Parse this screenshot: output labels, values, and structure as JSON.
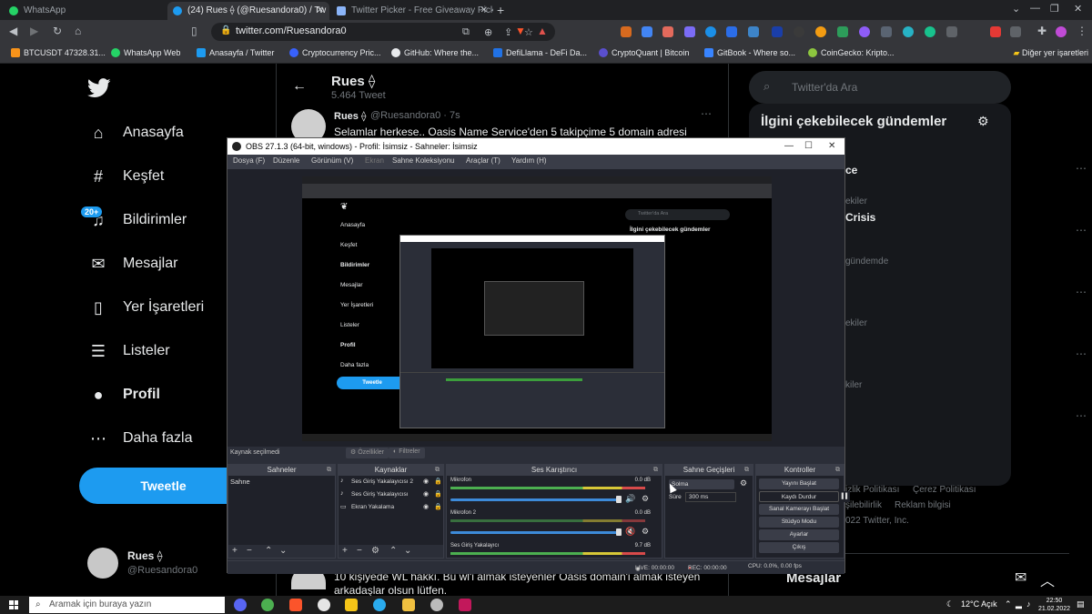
{
  "browser": {
    "tabs": [
      {
        "title": "WhatsApp",
        "icon": "whatsapp-icon",
        "color": "#25d366"
      },
      {
        "title": "(24) Rues ⟠ (@Ruesandora0) / Tw",
        "icon": "twitter-icon",
        "color": "#1d9bf0"
      },
      {
        "title": "Twitter Picker - Free Giveaway Picker",
        "icon": "twitter-picker-icon",
        "color": "#8ab4f8"
      }
    ],
    "new_tab": "+",
    "url": "twitter.com/Ruesandora0",
    "bookmarks": [
      {
        "label": "BTCUSDT 47328.31...",
        "color": "#f7931a"
      },
      {
        "label": "WhatsApp Web",
        "color": "#25d366"
      },
      {
        "label": "Anasayfa / Twitter",
        "color": "#1d9bf0"
      },
      {
        "label": "Cryptocurrency Pric...",
        "color": "#3861fb"
      },
      {
        "label": "GitHub: Where the...",
        "color": "#e8eaed"
      },
      {
        "label": "DefiLlama - DeFi Da...",
        "color": "#2172e5"
      },
      {
        "label": "CryptoQuant | Bitcoin",
        "color": "#5a4fcf"
      },
      {
        "label": "GitBook - Where so...",
        "color": "#3884ff"
      },
      {
        "label": "CoinGecko: Kripto...",
        "color": "#8dc63f"
      }
    ],
    "bookmarks_other": "Diğer yer işaretleri"
  },
  "twitter": {
    "nav": [
      {
        "label": "Anasayfa",
        "icon": "home-icon",
        "glyph": "⌂"
      },
      {
        "label": "Keşfet",
        "icon": "hashtag-icon",
        "glyph": "#"
      },
      {
        "label": "Bildirimler",
        "icon": "bell-icon",
        "glyph": "🔔"
      },
      {
        "label": "Mesajlar",
        "icon": "mail-icon",
        "glyph": "✉"
      },
      {
        "label": "Yer İşaretleri",
        "icon": "bookmark-icon",
        "glyph": "🔖"
      },
      {
        "label": "Listeler",
        "icon": "list-icon",
        "glyph": "☰"
      },
      {
        "label": "Profil",
        "icon": "profile-icon",
        "glyph": "👤"
      },
      {
        "label": "Daha fazla",
        "icon": "more-icon",
        "glyph": "⋯"
      }
    ],
    "notif_badge": "20+",
    "tweet_button": "Tweetle",
    "account": {
      "name": "Rues ⟠",
      "handle": "@Ruesandora0"
    },
    "header": {
      "name": "Rues ⟠",
      "tweet_count": "5.464 Tweet"
    },
    "tweet": {
      "name": "Rues ⟠",
      "handle": "@Ruesandora0 · 7s",
      "text": "Selamlar herkese.. Oasis Name Service'den 5 takipçime 5 domain adresi"
    },
    "tweet_bottom": "10 kişiyede WL hakkı. Bu wl'i almak isteyenler Oasis domain'i almak isteyen arkadaşlar olsun lütfen.",
    "search_placeholder": "Twitter'da Ara",
    "trends_title": "İlgini çekebilecek gündemler",
    "trend_fragments": [
      "ce",
      "ekiler",
      "Crisis",
      "gündemde",
      "ekiler",
      "kiler"
    ],
    "footer": [
      "izlik Politikası",
      "Çerez Politikası",
      "şilebilirlik",
      "Reklam bilgisi",
      "022 Twitter, Inc."
    ],
    "messages_dock": "Mesajlar"
  },
  "obs": {
    "title": "OBS 27.1.3 (64-bit, windows) - Profil: İsimsiz - Sahneler: İsimsiz",
    "menu": [
      "Dosya (F)",
      "Düzenle",
      "Görünüm (V)",
      "Ekran",
      "Sahne Koleksiyonu",
      "Araçlar (T)",
      "Yardım (H)"
    ],
    "no_source": "Kaynak seçilmedi",
    "properties": "Özellikler",
    "filters": "Filtreler",
    "panels": {
      "scenes": "Sahneler",
      "sources": "Kaynaklar",
      "mixer": "Ses Karıştırıcı",
      "transitions": "Sahne Geçişleri",
      "controls": "Kontroller"
    },
    "scene_items": [
      "Sahne"
    ],
    "source_items": [
      "Ses Giriş Yakalayıcısı 2",
      "Ses Giriş Yakalayıcısı",
      "Ekran Yakalama"
    ],
    "mixer_tracks": [
      {
        "name": "Mikrofon",
        "db": "0.0 dB"
      },
      {
        "name": "Mikrofon 2",
        "db": "0.0 dB"
      },
      {
        "name": "Ses Giriş Yakalayıcı",
        "db": "9.7 dB"
      }
    ],
    "transition": {
      "type": "Solma",
      "duration_label": "Süre",
      "duration": "300 ms"
    },
    "controls": [
      "Yayını Başlat",
      "Kaydı Durdur",
      "Sanal Kamerayı Başlat",
      "Stüdyo Modu",
      "Ayarlar",
      "Çıkış"
    ],
    "pause": "▌▌",
    "status": {
      "live": "LIVE: 00:00:00",
      "rec": "REC: 00:00:00",
      "cpu": "CPU: 0.0%, 0.00 fps"
    },
    "inner_preview": {
      "nav": [
        "Anasayfa",
        "Keşfet",
        "Bildirimler",
        "Mesajlar",
        "Yer İşaretleri",
        "Listeler",
        "Profil",
        "Daha fazla"
      ],
      "tweet_button": "Tweetle",
      "trends": "İlgini çekebilecek gündemler",
      "search": "Twitter'da Ara"
    }
  },
  "taskbar": {
    "search_placeholder": "Aramak için buraya yazın",
    "weather": "12°C  Açık",
    "time": "22:50",
    "date": "21.02.2022"
  }
}
